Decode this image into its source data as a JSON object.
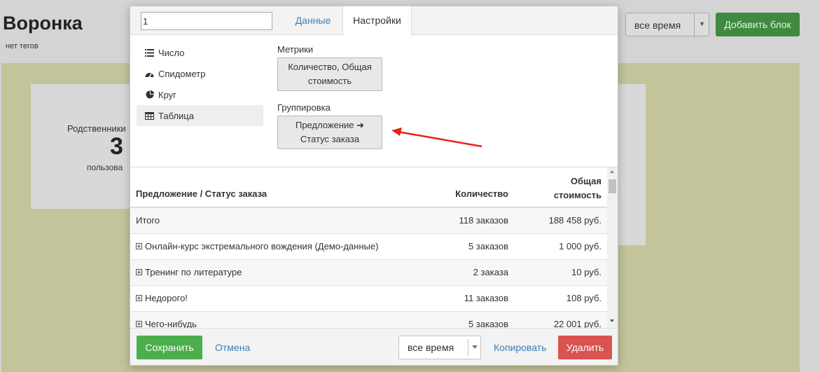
{
  "background": {
    "title": "Воронка",
    "tags": "нет тегов",
    "period_select": "все время",
    "add_block_label": "Добавить блок",
    "card": {
      "label": "Родственники",
      "value": "3",
      "sub": "пользова"
    }
  },
  "modal": {
    "name_value": "1",
    "tabs": [
      {
        "label": "Данные",
        "active": false
      },
      {
        "label": "Настройки",
        "active": true
      }
    ],
    "types": [
      {
        "label": "Число",
        "icon": "list-icon",
        "active": false
      },
      {
        "label": "Спидометр",
        "icon": "gauge-icon",
        "active": false
      },
      {
        "label": "Круг",
        "icon": "pie-chart-icon",
        "active": false
      },
      {
        "label": "Таблица",
        "icon": "table-icon",
        "active": true
      }
    ],
    "metrics_label": "Метрики",
    "metrics_value_line1": "Количество, Общая",
    "metrics_value_line2": "стоимость",
    "grouping_label": "Группировка",
    "grouping_value_line1": "Предложение ➜",
    "grouping_value_line2": "Статус заказа",
    "annotation_arrow_color": "#e8211c"
  },
  "table": {
    "headers": {
      "name": "Предложение / Статус заказа",
      "qty": "Количество",
      "cost_line1": "Общая",
      "cost_line2": "стоимость"
    },
    "rows": [
      {
        "name": "Итого",
        "qty": "118 заказов",
        "cost": "188 458 руб.",
        "expandable": false
      },
      {
        "name": "Онлайн-курс экстремального вождения (Демо-данные)",
        "qty": "5 заказов",
        "cost": "1 000 руб.",
        "expandable": true
      },
      {
        "name": "Тренинг по литературе",
        "qty": "2 заказа",
        "cost": "10 руб.",
        "expandable": true
      },
      {
        "name": "Недорого!",
        "qty": "11 заказов",
        "cost": "108 руб.",
        "expandable": true
      },
      {
        "name": "Чего-нибудь",
        "qty": "5 заказов",
        "cost": "22 001 руб.",
        "expandable": true
      }
    ]
  },
  "footer": {
    "save_label": "Сохранить",
    "cancel_label": "Отмена",
    "period_select": "все время",
    "copy_label": "Копировать",
    "delete_label": "Удалить"
  },
  "colors": {
    "save": "#4cae4c",
    "delete": "#d9534f",
    "link": "#3d7eb6"
  }
}
